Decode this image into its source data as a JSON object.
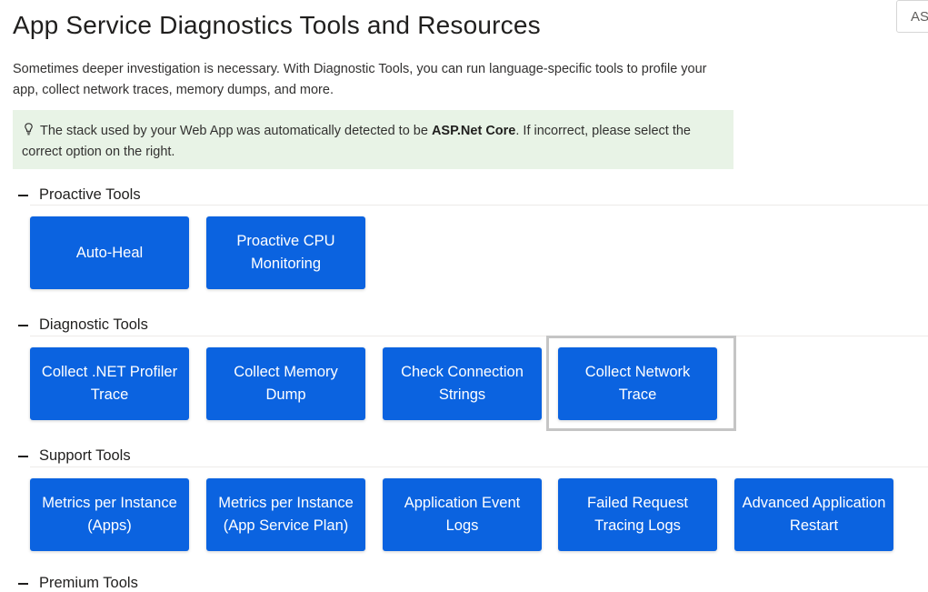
{
  "page": {
    "title": "App Service Diagnostics Tools and Resources",
    "stack_selector_value": "ASP.Net Core",
    "intro": "Sometimes deeper investigation is necessary. With Diagnostic Tools, you can run language-specific tools to profile your app, collect network traces, memory dumps, and more."
  },
  "info": {
    "icon": "lightbulb-icon",
    "prefix": "The stack used by your Web App was automatically detected to be ",
    "stack": "ASP.Net Core",
    "suffix": ". If incorrect, please select the correct option on the right."
  },
  "sections": {
    "proactive": {
      "title": "Proactive Tools",
      "tools": [
        "Auto-Heal",
        "Proactive CPU Monitoring"
      ]
    },
    "diagnostic": {
      "title": "Diagnostic Tools",
      "tools": [
        "Collect .NET Profiler Trace",
        "Collect Memory Dump",
        "Check Connection Strings",
        "Collect Network Trace"
      ],
      "focused_tool": "Collect Network Trace"
    },
    "support": {
      "title": "Support Tools",
      "tools": [
        "Metrics per Instance (Apps)",
        "Metrics per Instance (App Service Plan)",
        "Application Event Logs",
        "Failed Request Tracing Logs",
        "Advanced Application Restart"
      ]
    },
    "next": {
      "title": "Premium Tools"
    }
  },
  "colors": {
    "button_bg": "#0b63e0",
    "info_bg": "#e8f3e6",
    "focus_border": "#c5c5c5"
  }
}
